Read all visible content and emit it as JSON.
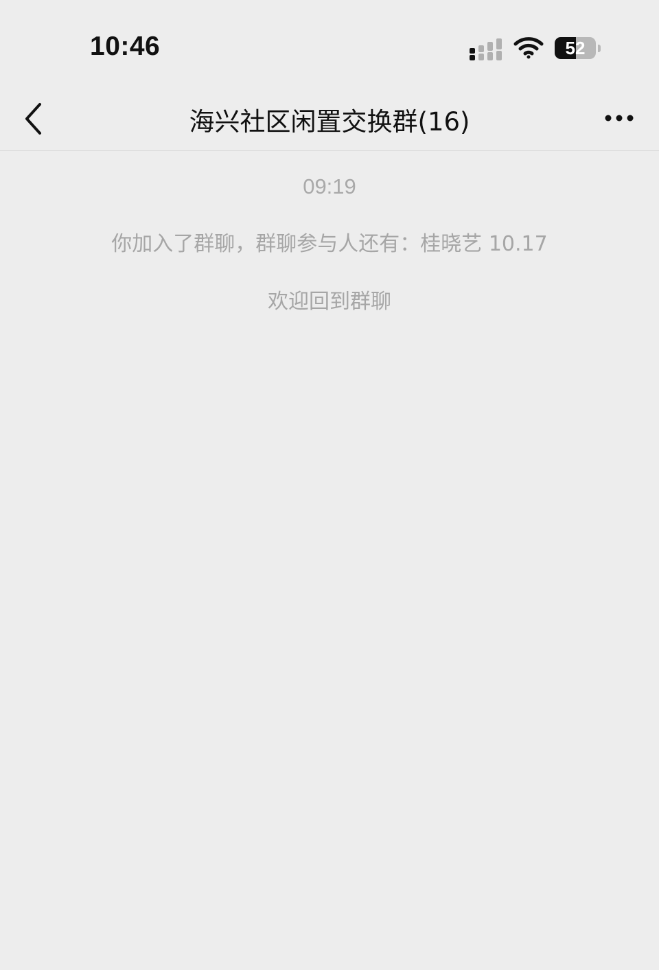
{
  "status_bar": {
    "time": "10:46",
    "battery_level": "52",
    "battery_fraction": 0.52,
    "signal_icon": "cellular-signal-icon",
    "wifi_icon": "wifi-icon"
  },
  "nav": {
    "back_icon": "chevron-left-icon",
    "title": "海兴社区闲置交换群(16)",
    "more_icon": "ellipsis-icon"
  },
  "chat": {
    "timestamp": "09:19",
    "messages": [
      "你加入了群聊，群聊参与人还有：桂晓艺 10.17",
      "欢迎回到群聊"
    ]
  },
  "colors": {
    "background": "#ededed",
    "title_text": "#111111",
    "system_text": "#a6a6a6"
  }
}
